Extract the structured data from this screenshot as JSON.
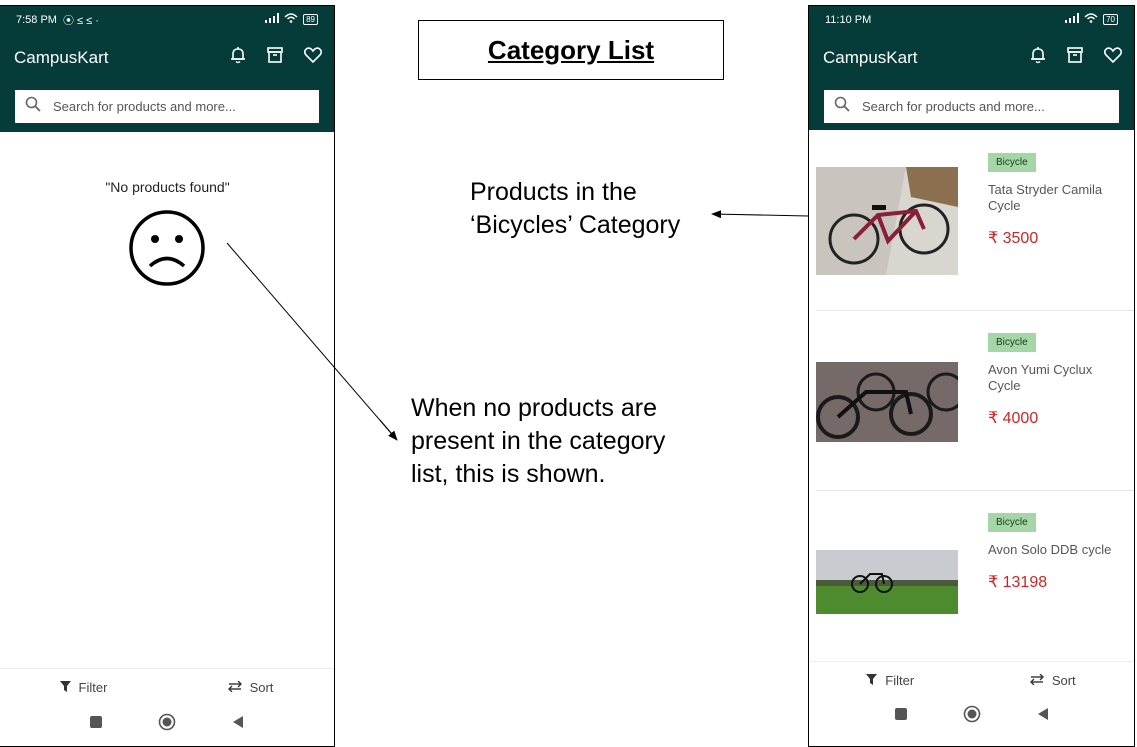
{
  "title": "Category List",
  "left_phone": {
    "status_time": "7:58 PM",
    "status_icons": "⦿ ≤ ≤ ·",
    "battery": "89",
    "app_title": "CampusKart",
    "search_placeholder": "Search for products and more...",
    "empty_message": "\"No products found\"",
    "filter_label": "Filter",
    "sort_label": "Sort"
  },
  "right_phone": {
    "status_time": "11:10 PM",
    "battery": "70",
    "app_title": "CampusKart",
    "search_placeholder": "Search for products and more...",
    "products": [
      {
        "category": "Bicycle",
        "name": "Tata Stryder Camila Cycle",
        "price": "₹ 3500"
      },
      {
        "category": "Bicycle",
        "name": "Avon Yumi Cyclux Cycle",
        "price": "₹ 4000"
      },
      {
        "category": "Bicycle",
        "name": "Avon Solo DDB cycle",
        "price": "₹ 13198"
      }
    ],
    "filter_label": "Filter",
    "sort_label": "Sort"
  },
  "annotations": {
    "products_note_line1": "Products in the",
    "products_note_line2": "‘Bicycles’ Category",
    "empty_note_line1": "When no products are",
    "empty_note_line2": "present in the category",
    "empty_note_line3": "list, this is shown."
  },
  "colors": {
    "appbar": "#053c3a",
    "price": "#c62828",
    "badge": "#a5d6a7"
  }
}
